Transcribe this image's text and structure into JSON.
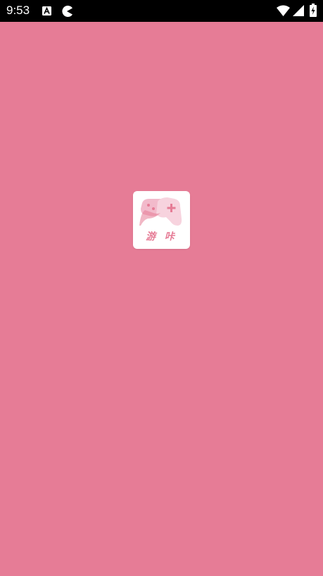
{
  "status_bar": {
    "time": "9:53",
    "icons": [
      "text-a-notification-icon",
      "pacman-notification-icon",
      "wifi-icon",
      "cell-signal-icon",
      "battery-charging-icon"
    ]
  },
  "splash": {
    "logo_text": "游 咔",
    "logo_icon": "gamepad-icon"
  },
  "colors": {
    "background": "#E67C96",
    "status_bar": "#000000",
    "logo_bg": "#FFFFFF"
  }
}
